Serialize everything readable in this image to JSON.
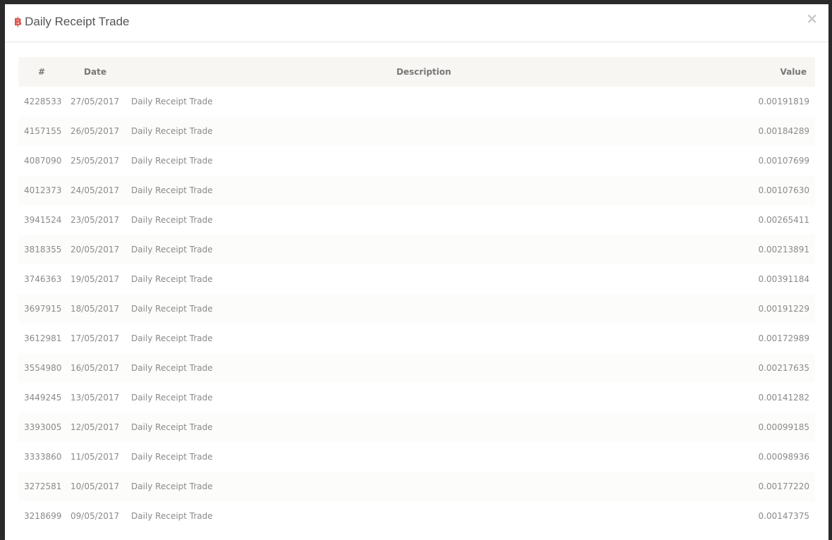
{
  "modal": {
    "title": "Daily Receipt Trade",
    "title_icon": "bitcoin-icon",
    "close_icon": "close-icon",
    "close_glyph": "×",
    "accent_color": "#d9534f"
  },
  "table": {
    "headers": {
      "id": "#",
      "date": "Date",
      "description": "Description",
      "value": "Value"
    },
    "rows": [
      {
        "id": "4228533",
        "date": "27/05/2017",
        "description": "Daily Receipt Trade",
        "value": "0.00191819"
      },
      {
        "id": "4157155",
        "date": "26/05/2017",
        "description": "Daily Receipt Trade",
        "value": "0.00184289"
      },
      {
        "id": "4087090",
        "date": "25/05/2017",
        "description": "Daily Receipt Trade",
        "value": "0.00107699"
      },
      {
        "id": "4012373",
        "date": "24/05/2017",
        "description": "Daily Receipt Trade",
        "value": "0.00107630"
      },
      {
        "id": "3941524",
        "date": "23/05/2017",
        "description": "Daily Receipt Trade",
        "value": "0.00265411"
      },
      {
        "id": "3818355",
        "date": "20/05/2017",
        "description": "Daily Receipt Trade",
        "value": "0.00213891"
      },
      {
        "id": "3746363",
        "date": "19/05/2017",
        "description": "Daily Receipt Trade",
        "value": "0.00391184"
      },
      {
        "id": "3697915",
        "date": "18/05/2017",
        "description": "Daily Receipt Trade",
        "value": "0.00191229"
      },
      {
        "id": "3612981",
        "date": "17/05/2017",
        "description": "Daily Receipt Trade",
        "value": "0.00172989"
      },
      {
        "id": "3554980",
        "date": "16/05/2017",
        "description": "Daily Receipt Trade",
        "value": "0.00217635"
      },
      {
        "id": "3449245",
        "date": "13/05/2017",
        "description": "Daily Receipt Trade",
        "value": "0.00141282"
      },
      {
        "id": "3393005",
        "date": "12/05/2017",
        "description": "Daily Receipt Trade",
        "value": "0.00099185"
      },
      {
        "id": "3333860",
        "date": "11/05/2017",
        "description": "Daily Receipt Trade",
        "value": "0.00098936"
      },
      {
        "id": "3272581",
        "date": "10/05/2017",
        "description": "Daily Receipt Trade",
        "value": "0.00177220"
      },
      {
        "id": "3218699",
        "date": "09/05/2017",
        "description": "Daily Receipt Trade",
        "value": "0.00147375"
      }
    ]
  }
}
